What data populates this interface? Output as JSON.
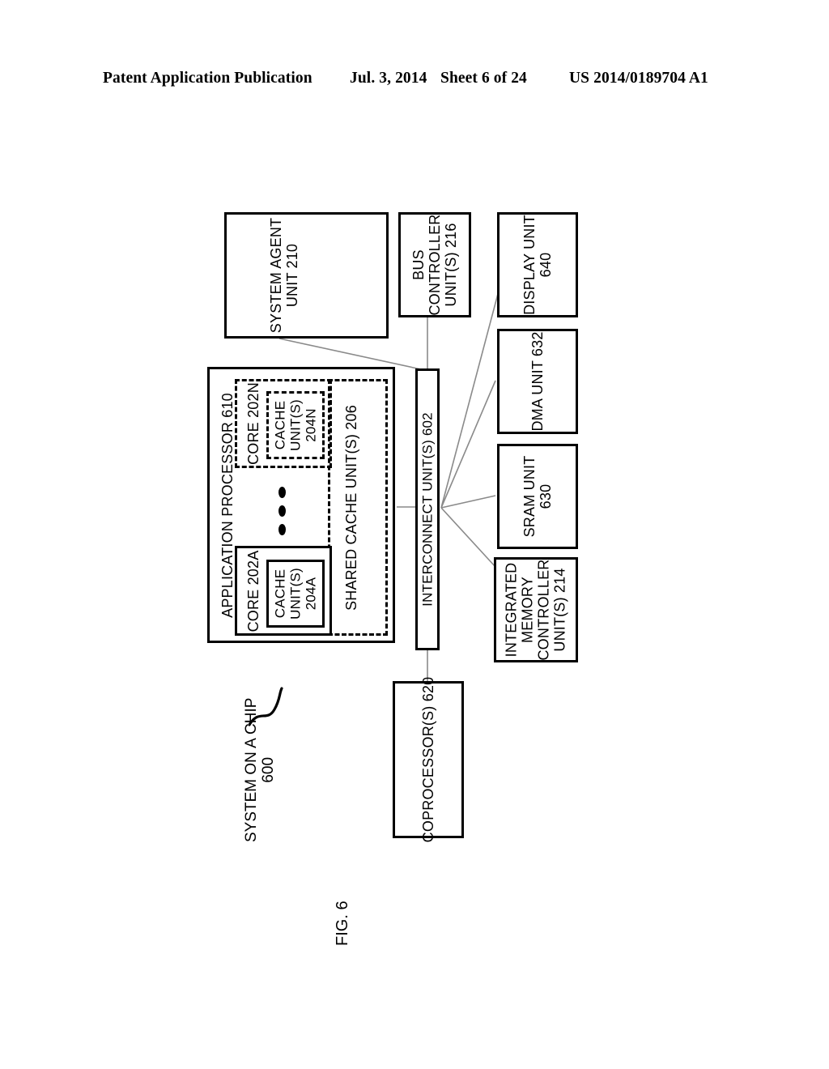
{
  "header": {
    "publication": "Patent Application Publication",
    "date": "Jul. 3, 2014",
    "sheet": "Sheet 6 of 24",
    "patent_number": "US 2014/0189704 A1"
  },
  "figure": {
    "label": "FIG. 6",
    "callout_title": "SYSTEM ON A CHIP",
    "callout_number": "600"
  },
  "blocks": {
    "system_agent": {
      "line1": "SYSTEM AGENT",
      "line2": "UNIT 210"
    },
    "bus_controller": {
      "line1": "BUS",
      "line2": "CONTROLLER",
      "line3": "UNIT(S) 216"
    },
    "display_unit": {
      "line1": "DISPLAY UNIT",
      "line2": "640"
    },
    "dma_unit": {
      "line1": "DMA UNIT 632"
    },
    "sram_unit": {
      "line1": "SRAM UNIT",
      "line2": "630"
    },
    "integrated_memory_controller": {
      "line1": "INTEGRATED",
      "line2": "MEMORY",
      "line3": "CONTROLLER",
      "line4": "UNIT(S) 214"
    },
    "interconnect": {
      "line1": "INTERCONNECT UNIT(S) 602"
    },
    "coprocessor": {
      "line1": "COPROCESSOR(S) 620"
    },
    "application_processor": {
      "line1": "APPLICATION PROCESSOR 610"
    },
    "shared_cache": {
      "line1": "SHARED CACHE UNIT(S) 206"
    },
    "core_a": {
      "line1": "CORE 202A"
    },
    "cache_a": {
      "line1": "CACHE",
      "line2": "UNIT(S)",
      "line3": "204A"
    },
    "core_n": {
      "line1": "CORE 202N"
    },
    "cache_n": {
      "line1": "CACHE",
      "line2": "UNIT(S)",
      "line3": "204N"
    }
  },
  "colors": {
    "ink": "#000000",
    "paper": "#ffffff",
    "connector": "#888888"
  }
}
